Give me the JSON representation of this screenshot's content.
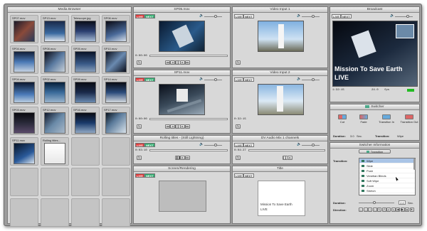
{
  "colors": {
    "live": "#d33333",
    "next": "#2aa86a",
    "window": "#9c9c9c",
    "panel": "#d8d8d8"
  },
  "browser": {
    "title": "Media Browser",
    "items": [
      {
        "name": "SP07.mov"
      },
      {
        "name": "SP13.mov"
      },
      {
        "name": "Telescope.jpg"
      },
      {
        "name": "SP06.mov"
      },
      {
        "name": "SP04.mov"
      },
      {
        "name": "SP08.mov"
      },
      {
        "name": "SP05.mov"
      },
      {
        "name": "SP10.mov"
      },
      {
        "name": "SP04.mov"
      },
      {
        "name": "SP02.mov"
      },
      {
        "name": "SP09.mov"
      },
      {
        "name": "SP14.mov"
      },
      {
        "name": "SP03.mov"
      },
      {
        "name": "SP12.mov"
      },
      {
        "name": "SP16.mov"
      },
      {
        "name": "SP17.mov"
      },
      {
        "name": "SP11.mov"
      },
      {
        "name": "Rolling titles..."
      }
    ]
  },
  "sources": [
    {
      "title": "SP05.mov",
      "live": "LIVE",
      "next": "NEXT",
      "time": "0:00:00"
    },
    {
      "title": "SP11.mov",
      "live": "LIVE",
      "next": "NEXT",
      "time": "0:00:00"
    },
    {
      "title": "Rolling titles - (Still Lightning)",
      "live": "LIVE",
      "next": "NEXT",
      "time": "0:03:10"
    },
    {
      "title": "Screen/Rendering",
      "live": "LIVE",
      "next": "NEXT"
    }
  ],
  "sources2": [
    {
      "title": "Video Input 1",
      "live": "LIVE",
      "next": "NEXT"
    },
    {
      "title": "Video Input 2",
      "live": "LIVE",
      "next": "NEXT",
      "time": "0:32:15"
    },
    {
      "title": "DV Audio Mix 1 channels",
      "live": "LIVE",
      "next": "NEXT",
      "time": "0:04:27"
    },
    {
      "title": "Title",
      "live": "LIVE",
      "next": "NEXT",
      "title_text": "Mission To Save Earth",
      "title_text2": "LIVE"
    }
  ],
  "program": {
    "title": "Broadcast",
    "live": "LIVE",
    "next": "NEXT",
    "overlay_line1": "Mission To Save Earth",
    "overlay_line2": "LIVE",
    "time": "1:32:15",
    "fps": "24.0",
    "fps_unit": "fps"
  },
  "switcher": {
    "title": "Switcher",
    "buttons": [
      {
        "label": "Cut"
      },
      {
        "label": "Fade"
      },
      {
        "label": "Transition In"
      },
      {
        "label": "Transition Out"
      }
    ],
    "duration_label": "Duration:",
    "duration_value": "3.0",
    "duration_unit": "Sec.",
    "transition_label": "Transition:",
    "transition_value": "Wipe"
  },
  "switcher_info": {
    "title": "Switcher Information",
    "tab": "Transition",
    "transition_label": "Transition:",
    "transitions": [
      {
        "label": "Wipe"
      },
      {
        "label": "Slide"
      },
      {
        "label": "Push"
      },
      {
        "label": "Venetian Blinds"
      },
      {
        "label": "Soft Wipe"
      },
      {
        "label": "Zoom"
      },
      {
        "label": "Stretch"
      }
    ],
    "duration_label": "Duration:",
    "duration_value": "2.0",
    "duration_unit": "Sec.",
    "direction_label": "Direction:"
  }
}
